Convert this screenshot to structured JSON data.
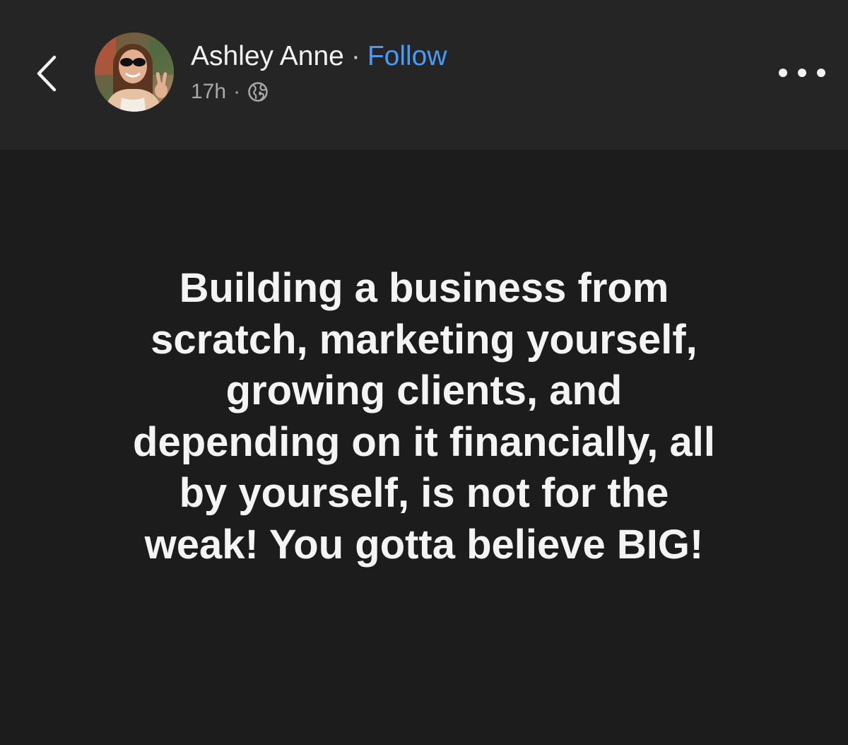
{
  "header": {
    "author_name": "Ashley Anne",
    "separator": "·",
    "follow_label": "Follow",
    "timestamp": "17h",
    "meta_separator": "·",
    "audience_icon": "globe-icon",
    "back_icon": "chevron-left-icon",
    "more_icon": "more-horizontal-icon"
  },
  "post": {
    "lines": [
      "Building a business from",
      "scratch, marketing yourself,",
      "growing clients, and",
      "depending on it financially, all",
      "by yourself, is not for the",
      "weak! You gotta believe BIG!"
    ]
  },
  "colors": {
    "header_bg": "#252526",
    "body_bg": "#1c1c1c",
    "text": "#f4f4f4",
    "secondary_text": "#a8a8a8",
    "link": "#4a9af5"
  }
}
